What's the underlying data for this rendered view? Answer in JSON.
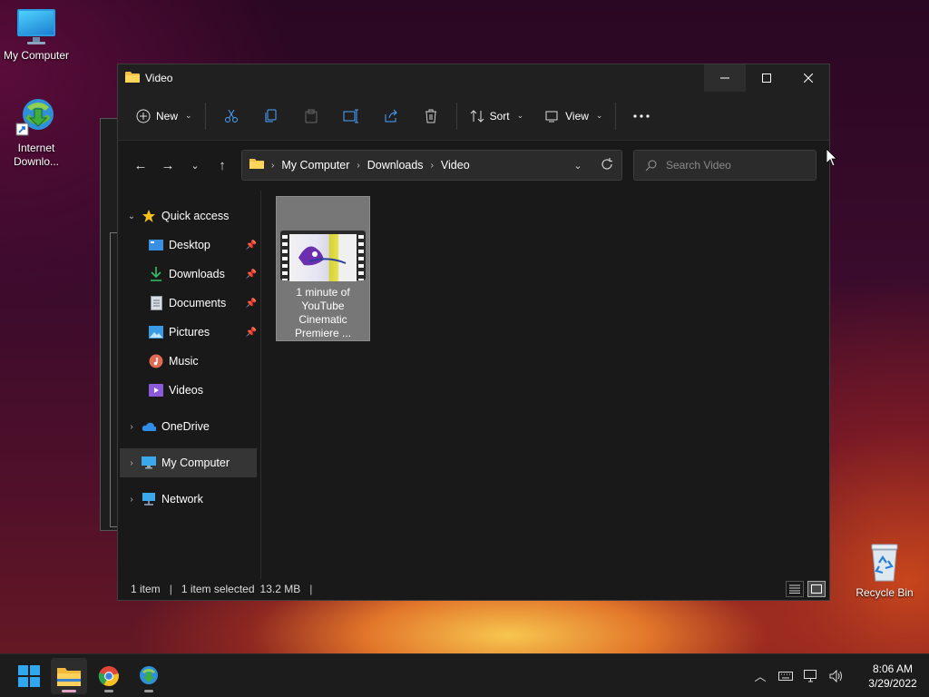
{
  "desktop": {
    "icons": [
      {
        "label": "My Computer"
      },
      {
        "label": "Internet Downlo..."
      },
      {
        "label": "Recycle Bin"
      }
    ]
  },
  "window": {
    "title": "Video",
    "toolbar": {
      "new_label": "New",
      "sort_label": "Sort",
      "view_label": "View"
    },
    "breadcrumb": [
      "My Computer",
      "Downloads",
      "Video"
    ],
    "search_placeholder": "Search Video",
    "nav": {
      "quick_access": "Quick access",
      "items": [
        {
          "label": "Desktop",
          "pinned": true
        },
        {
          "label": "Downloads",
          "pinned": true
        },
        {
          "label": "Documents",
          "pinned": true
        },
        {
          "label": "Pictures",
          "pinned": true
        },
        {
          "label": "Music",
          "pinned": false
        },
        {
          "label": "Videos",
          "pinned": false
        }
      ],
      "roots": [
        {
          "label": "OneDrive"
        },
        {
          "label": "My Computer",
          "selected": true
        },
        {
          "label": "Network"
        }
      ]
    },
    "files": [
      {
        "name": "1 minute of YouTube Cinematic Premiere ...",
        "name_lines": [
          "1 minute of",
          "YouTube",
          "Cinematic",
          "Premiere ..."
        ],
        "selected": true
      }
    ],
    "status": {
      "count": "1 item",
      "selection": "1 item selected",
      "size": "13.2 MB"
    }
  },
  "taskbar": {
    "time": "8:06 AM",
    "date": "3/29/2022"
  },
  "colors": {
    "accent": "#0078d4",
    "folder": "#f0c04a",
    "window_bg": "#191919"
  }
}
